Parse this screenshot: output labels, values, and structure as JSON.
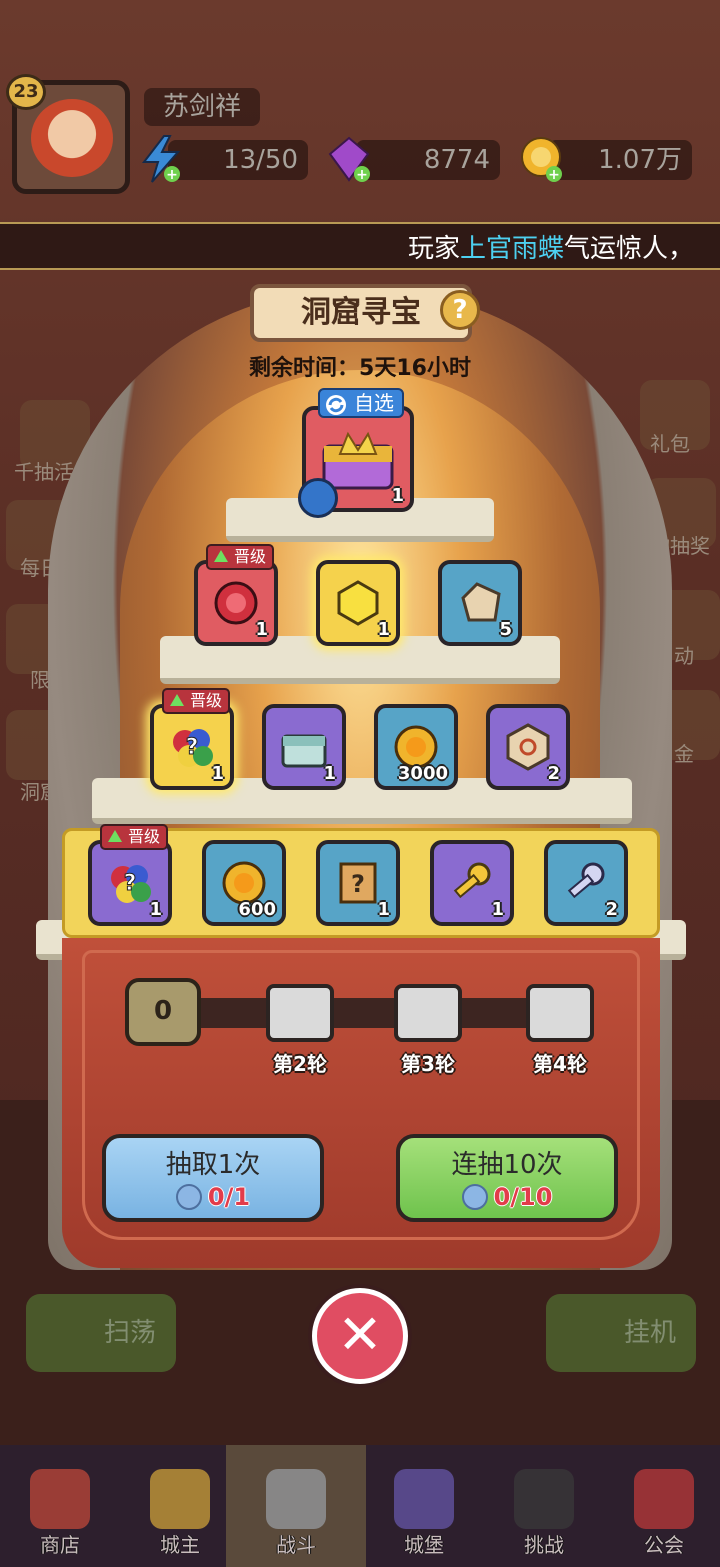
{
  "player": {
    "level": "23",
    "name": "苏剑祥",
    "energy": "13/50",
    "gems": "8774",
    "gold": "1.07万"
  },
  "marquee": {
    "prefix": "玩家",
    "highlight": "上官雨蝶",
    "suffix": "气运惊人，"
  },
  "side_menu": {
    "left": [
      "千抽活",
      "每日",
      "限",
      "洞窟"
    ],
    "right": [
      "礼包",
      "物抽奖",
      "动",
      "金"
    ]
  },
  "event": {
    "title": "洞窟寻宝",
    "remaining_time": "剩余时间：5天16小时",
    "top_tag": "自选",
    "top_item": {
      "icon": "crown-chest-icon",
      "qty": "1"
    },
    "upgrade_tag": "晋级",
    "rows": [
      [
        {
          "icon": "red-gem-icon",
          "qty": "1",
          "color": "red",
          "tag": true
        },
        {
          "icon": "gold-gem-icon",
          "qty": "1",
          "color": "gold",
          "tag": false
        },
        {
          "icon": "rune-stone-icon",
          "qty": "5",
          "color": "blue",
          "tag": false
        }
      ],
      [
        {
          "icon": "random-gem-icon",
          "qty": "1",
          "color": "gold",
          "tag": true
        },
        {
          "icon": "silver-chest-icon",
          "qty": "1",
          "color": "purple",
          "tag": false
        },
        {
          "icon": "gold-coin-icon",
          "qty": "3000",
          "color": "blue",
          "tag": false
        },
        {
          "icon": "sun-rune-icon",
          "qty": "2",
          "color": "purple",
          "tag": false
        }
      ],
      [
        {
          "icon": "random-gem-icon",
          "qty": "1",
          "color": "purple",
          "tag": true
        },
        {
          "icon": "gold-coin-icon",
          "qty": "600",
          "color": "blue",
          "tag": false
        },
        {
          "icon": "mystery-scroll-icon",
          "qty": "1",
          "color": "blue",
          "tag": false
        },
        {
          "icon": "gold-key-icon",
          "qty": "1",
          "color": "purple",
          "tag": false
        },
        {
          "icon": "silver-key-icon",
          "qty": "2",
          "color": "blue",
          "tag": false
        }
      ]
    ],
    "progress_count": "0",
    "rounds": [
      "第2轮",
      "第3轮",
      "第4轮"
    ],
    "draw_once": {
      "label": "抽取1次",
      "cost": "0/1"
    },
    "draw_ten": {
      "label": "连抽10次",
      "cost": "0/10"
    }
  },
  "background_buttons": {
    "sweep": "扫荡",
    "idle": "挂机"
  },
  "nav": [
    "商店",
    "城主",
    "战斗",
    "城堡",
    "挑战",
    "公会"
  ],
  "colors": {
    "accent_blue": "#4dd0f0",
    "cost_red": "#e23c4a",
    "close_red": "#e04d62"
  }
}
